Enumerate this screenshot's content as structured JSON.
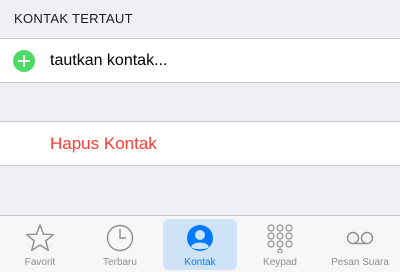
{
  "section": {
    "header": "KONTAK TERTAUT"
  },
  "link_cell": {
    "label": "tautkan kontak..."
  },
  "delete_cell": {
    "label": "Hapus Kontak"
  },
  "tabbar": {
    "tabs": [
      {
        "label": "Favorit",
        "icon": "star-icon"
      },
      {
        "label": "Terbaru",
        "icon": "clock-icon"
      },
      {
        "label": "Kontak",
        "icon": "person-icon",
        "active": true
      },
      {
        "label": "Keypad",
        "icon": "keypad-icon"
      },
      {
        "label": "Pesan Suara",
        "icon": "voicemail-icon"
      }
    ]
  },
  "colors": {
    "accent": "#007aff",
    "destructive": "#ff3b30",
    "add": "#4cd964",
    "inactive": "#8e8e93"
  }
}
